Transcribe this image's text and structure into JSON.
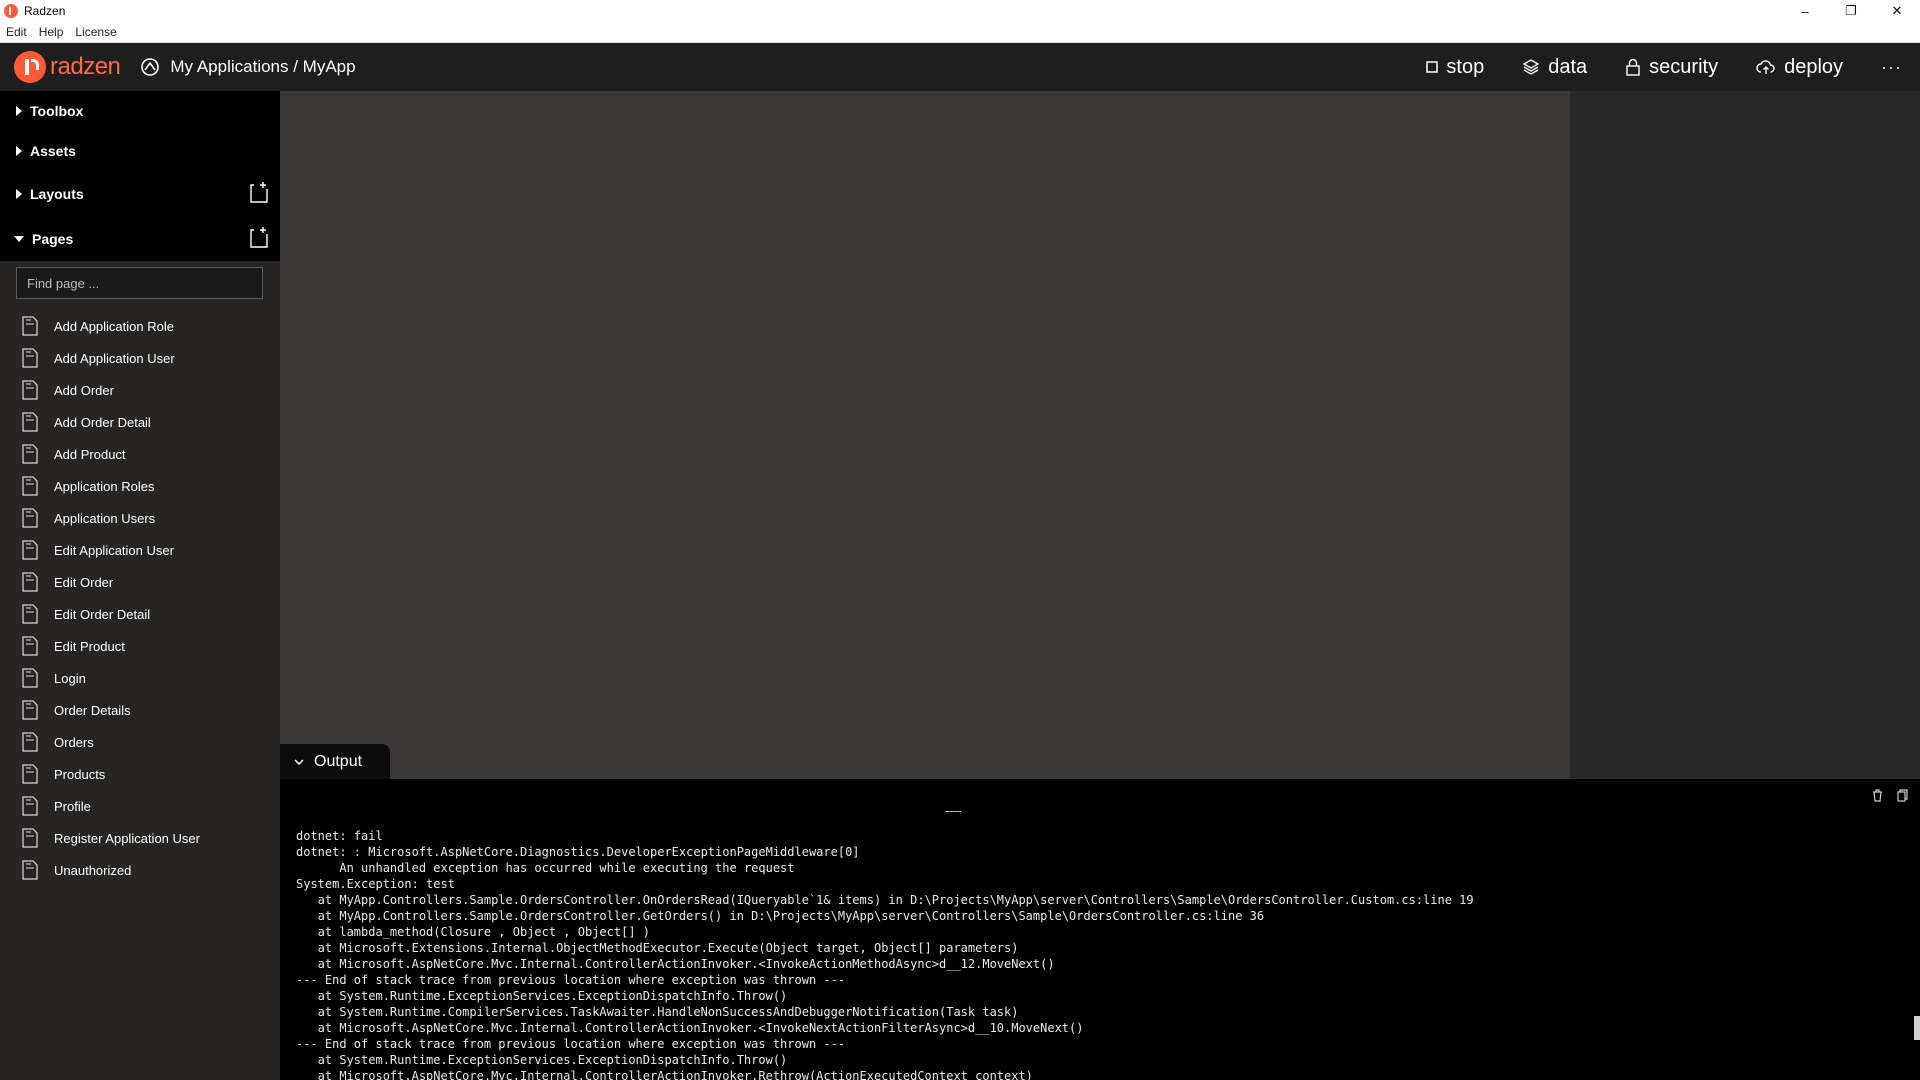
{
  "window": {
    "title": "Radzen",
    "minimize": "–",
    "restore": "❐",
    "close": "✕"
  },
  "menu": [
    "Edit",
    "Help",
    "License"
  ],
  "header": {
    "logo_text": "radzen",
    "breadcrumb": "My Applications / MyApp",
    "actions": {
      "stop": "stop",
      "data": "data",
      "security": "security",
      "deploy": "deploy"
    },
    "more": "···"
  },
  "sidebar": {
    "toolbox": "Toolbox",
    "assets": "Assets",
    "layouts": "Layouts",
    "pages": "Pages",
    "find_placeholder": "Find page ...",
    "page_items": [
      "Add Application Role",
      "Add Application User",
      "Add Order",
      "Add Order Detail",
      "Add Product",
      "Application Roles",
      "Application Users",
      "Edit Application User",
      "Edit Order",
      "Edit Order Detail",
      "Edit Product",
      "Login",
      "Order Details",
      "Orders",
      "Products",
      "Profile",
      "Register Application User",
      "Unauthorized"
    ]
  },
  "output": {
    "tab_label": "Output",
    "lines": [
      "dotnet: fail",
      "dotnet: : Microsoft.AspNetCore.Diagnostics.DeveloperExceptionPageMiddleware[0]",
      "      An unhandled exception has occurred while executing the request",
      "System.Exception: test",
      "   at MyApp.Controllers.Sample.OrdersController.OnOrdersRead(IQueryable`1& items) in D:\\Projects\\MyApp\\server\\Controllers\\Sample\\OrdersController.Custom.cs:line 19",
      "   at MyApp.Controllers.Sample.OrdersController.GetOrders() in D:\\Projects\\MyApp\\server\\Controllers\\Sample\\OrdersController.cs:line 36",
      "   at lambda_method(Closure , Object , Object[] )",
      "   at Microsoft.Extensions.Internal.ObjectMethodExecutor.Execute(Object target, Object[] parameters)",
      "   at Microsoft.AspNetCore.Mvc.Internal.ControllerActionInvoker.<InvokeActionMethodAsync>d__12.MoveNext()",
      "--- End of stack trace from previous location where exception was thrown ---",
      "   at System.Runtime.ExceptionServices.ExceptionDispatchInfo.Throw()",
      "   at System.Runtime.CompilerServices.TaskAwaiter.HandleNonSuccessAndDebuggerNotification(Task task)",
      "   at Microsoft.AspNetCore.Mvc.Internal.ControllerActionInvoker.<InvokeNextActionFilterAsync>d__10.MoveNext()",
      "--- End of stack trace from previous location where exception was thrown ---",
      "   at System.Runtime.ExceptionServices.ExceptionDispatchInfo.Throw()",
      "   at Microsoft.AspNetCore.Mvc.Internal.ControllerActionInvoker.Rethrow(ActionExecutedContext context)"
    ]
  },
  "colors": {
    "brand": "#ff5a36",
    "header_bg": "#1f1e1e",
    "canvas_bg": "#3b3837"
  }
}
